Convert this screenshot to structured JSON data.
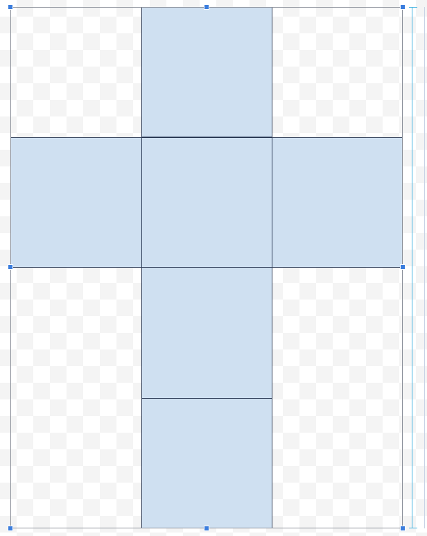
{
  "net": {
    "faces": [
      {
        "name": "face-top"
      },
      {
        "name": "face-left"
      },
      {
        "name": "face-center"
      },
      {
        "name": "face-right"
      },
      {
        "name": "face-lower"
      },
      {
        "name": "face-bottom"
      }
    ]
  },
  "colors": {
    "face_fill": "#cfe0f1",
    "face_border": "#2b3a55",
    "selection_border": "#8a8f99",
    "handle_fill": "#3b7ddd",
    "ruler": "#3fb1e0"
  },
  "selection": {
    "handles": [
      "top-left",
      "top-center",
      "top-right",
      "middle-left",
      "middle-right",
      "bottom-left",
      "bottom-center",
      "bottom-right"
    ]
  }
}
